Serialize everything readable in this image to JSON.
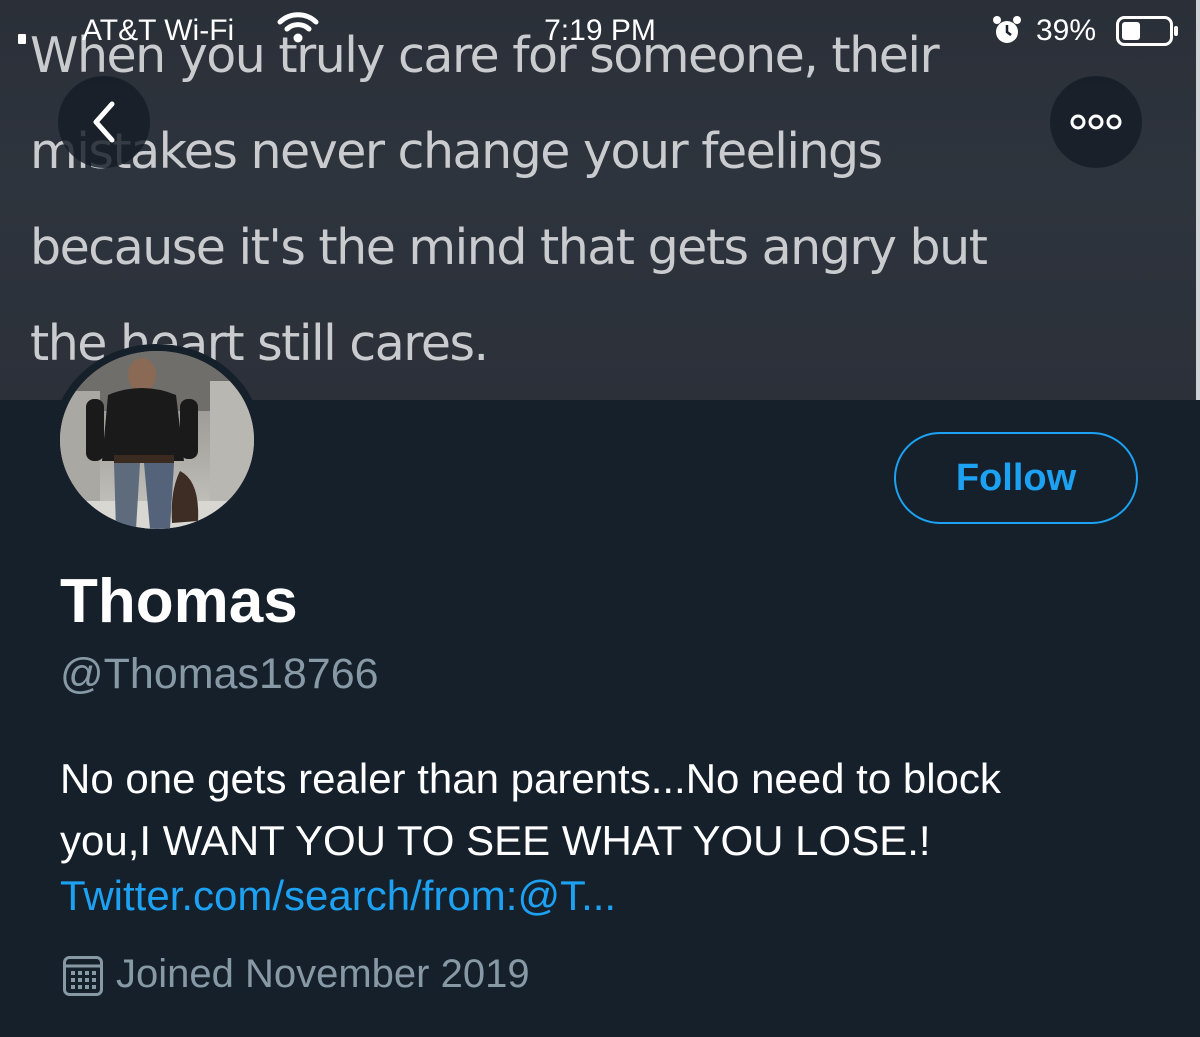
{
  "status_bar": {
    "carrier": "AT&T Wi-Fi",
    "time": "7:19 PM",
    "battery": "39%"
  },
  "banner": {
    "quote": "When you truly care for someone, their\nmistakes never change your feelings\nbecause it's the mind that gets angry but\nthe heart still cares."
  },
  "header": {
    "back_icon": "chevron-left-icon",
    "more_icon": "more-horizontal-icon"
  },
  "profile": {
    "name": "Thomas",
    "handle": "@Thomas18766",
    "follow_label": "Follow",
    "bio": "No one gets realer than parents...No need to block\nyou,I WANT YOU TO SEE WHAT YOU LOSE.!",
    "link": "Twitter.com/search/from:@T...",
    "joined": "Joined November 2019",
    "joined_icon": "calendar-icon"
  },
  "colors": {
    "background": "#15202b",
    "accent": "#1da1f2",
    "secondary_text": "#8899a6"
  }
}
